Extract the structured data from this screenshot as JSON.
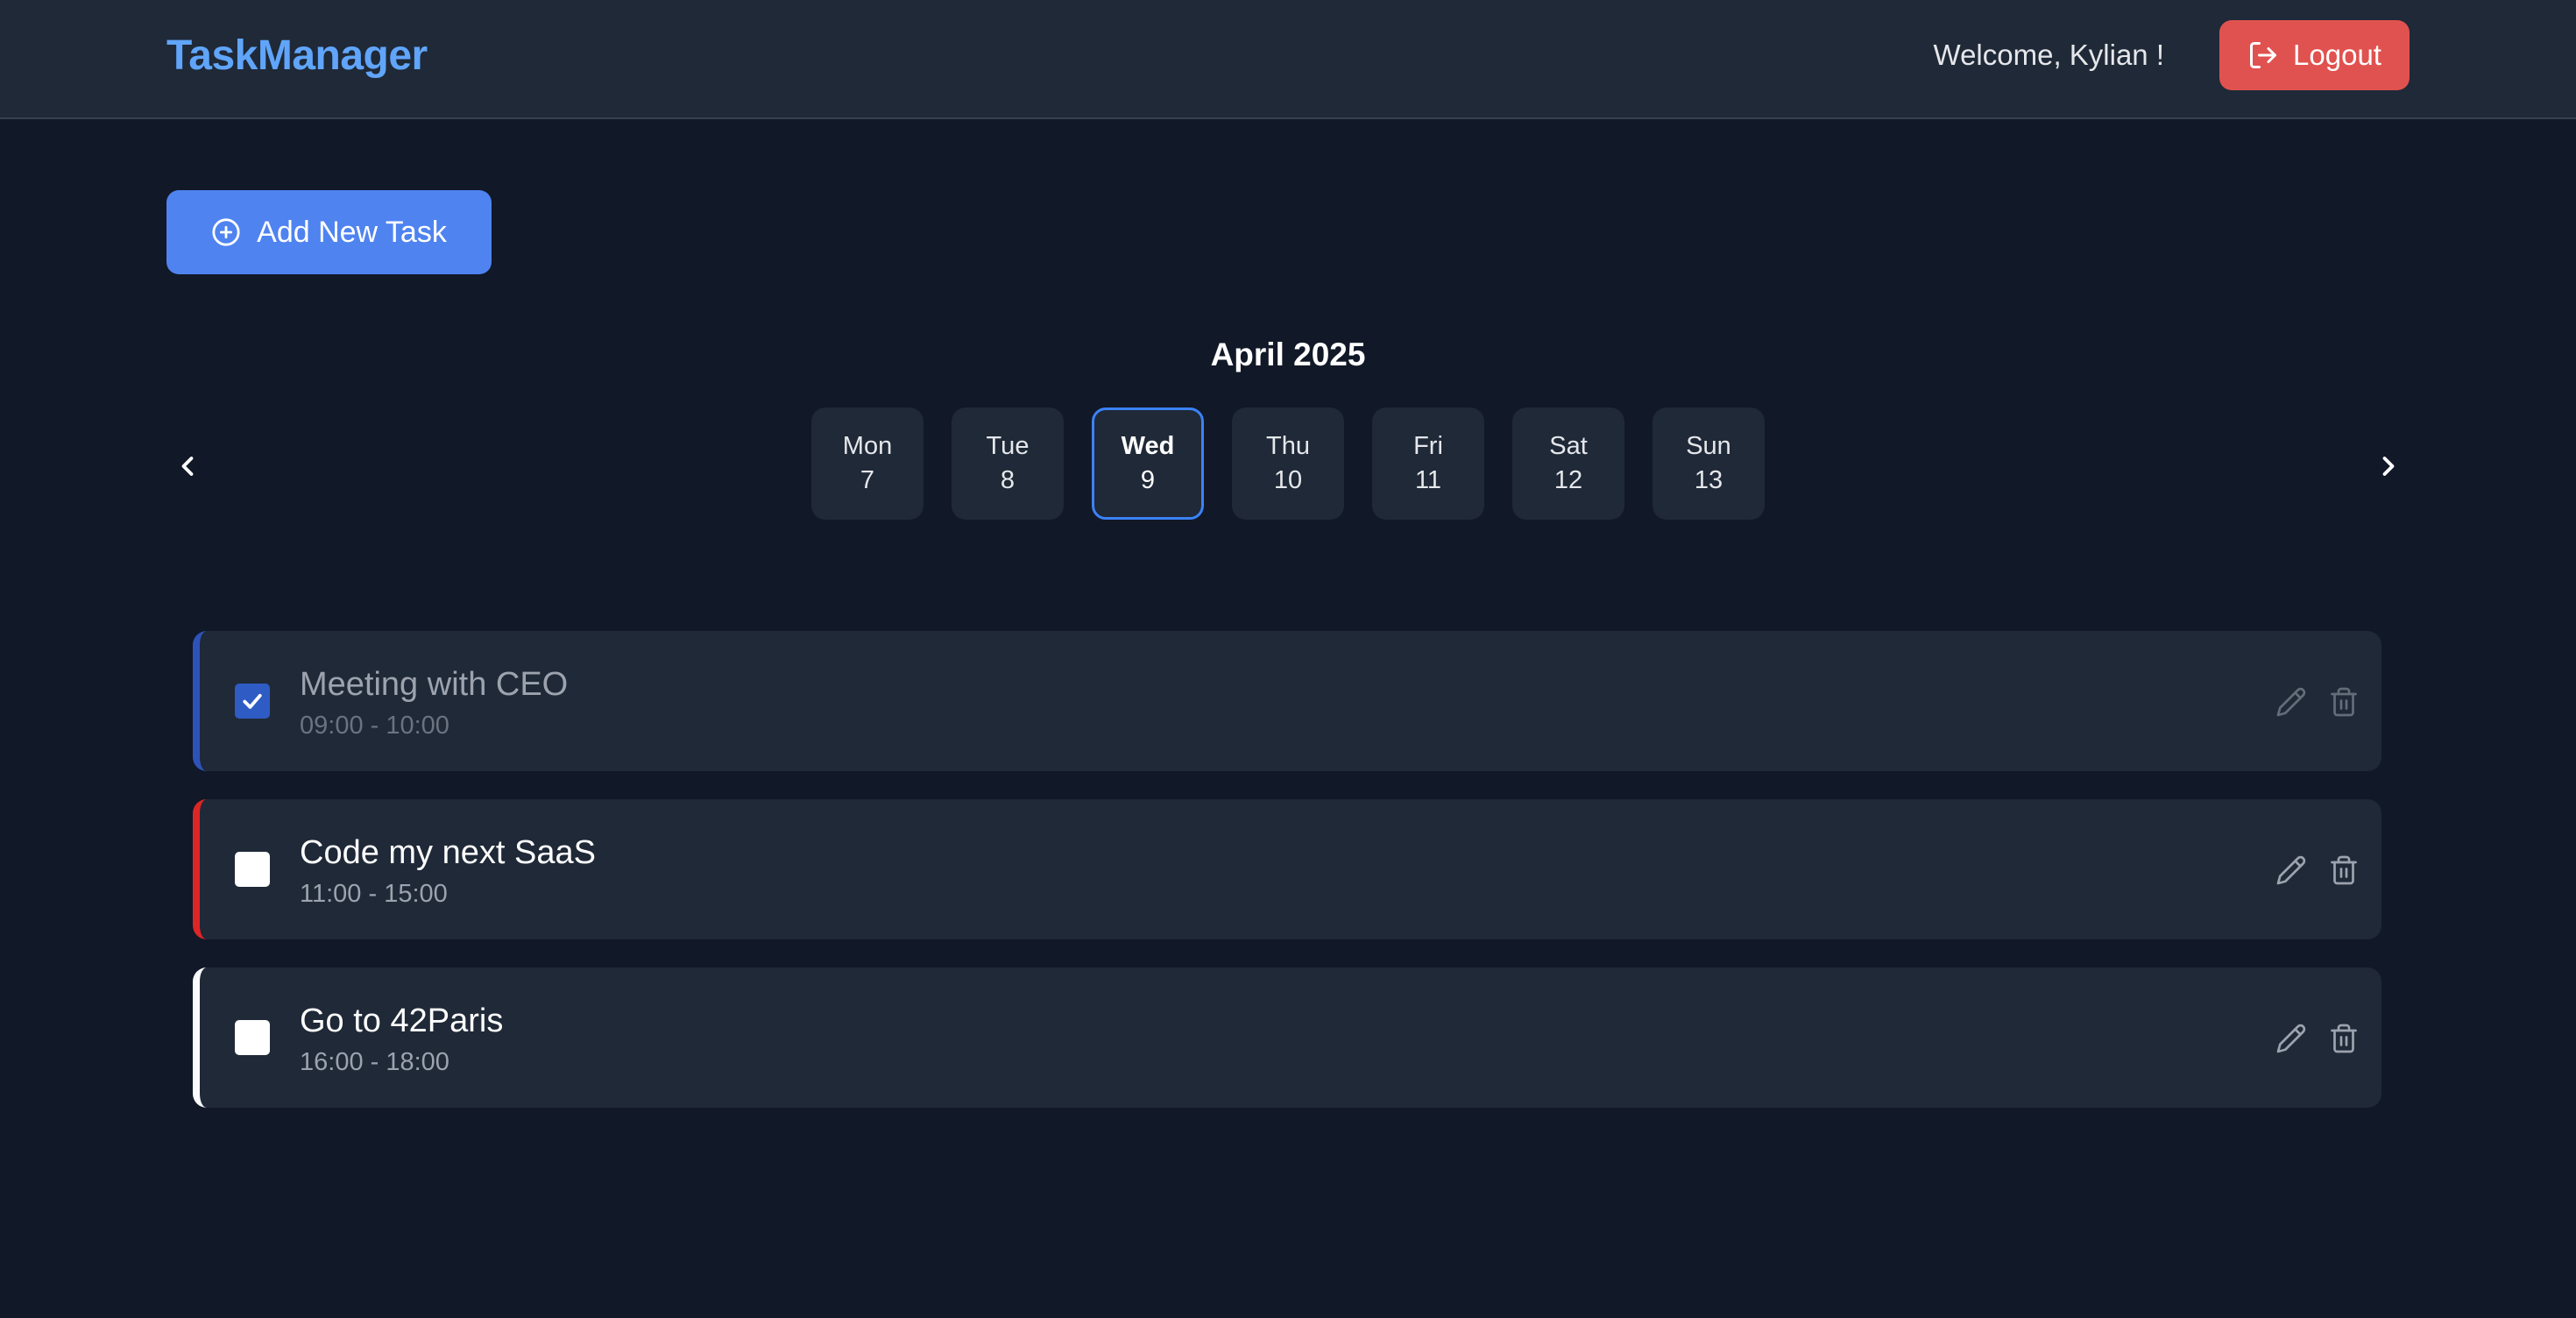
{
  "header": {
    "app_title": "TaskManager",
    "welcome": "Welcome, Kylian !",
    "logout_label": "Logout"
  },
  "toolbar": {
    "add_task_label": "Add New Task"
  },
  "calendar": {
    "month_label": "April 2025",
    "selected_index": 2,
    "days": [
      {
        "name": "Mon",
        "num": "7"
      },
      {
        "name": "Tue",
        "num": "8"
      },
      {
        "name": "Wed",
        "num": "9"
      },
      {
        "name": "Thu",
        "num": "10"
      },
      {
        "name": "Fri",
        "num": "11"
      },
      {
        "name": "Sat",
        "num": "12"
      },
      {
        "name": "Sun",
        "num": "13"
      }
    ]
  },
  "tasks": [
    {
      "title": "Meeting with CEO",
      "time": "09:00 - 10:00",
      "done": true,
      "accent": "#2e53b8"
    },
    {
      "title": "Code my next SaaS",
      "time": "11:00 - 15:00",
      "done": false,
      "accent": "#dc2626"
    },
    {
      "title": "Go to 42Paris",
      "time": "16:00 - 18:00",
      "done": false,
      "accent": "#f9fafb"
    }
  ],
  "colors": {
    "background": "#111827",
    "header": "#1f2937",
    "logo": "#60a5fa",
    "logout": "#e0524f",
    "primary": "#4f83f0",
    "selected_day_border": "#3b82f6"
  },
  "icons": {
    "logout": "logout-icon",
    "add": "plus-circle-icon",
    "prev": "chevron-left-icon",
    "next": "chevron-right-icon",
    "edit": "pencil-icon",
    "delete": "trash-icon",
    "check": "check-icon"
  }
}
